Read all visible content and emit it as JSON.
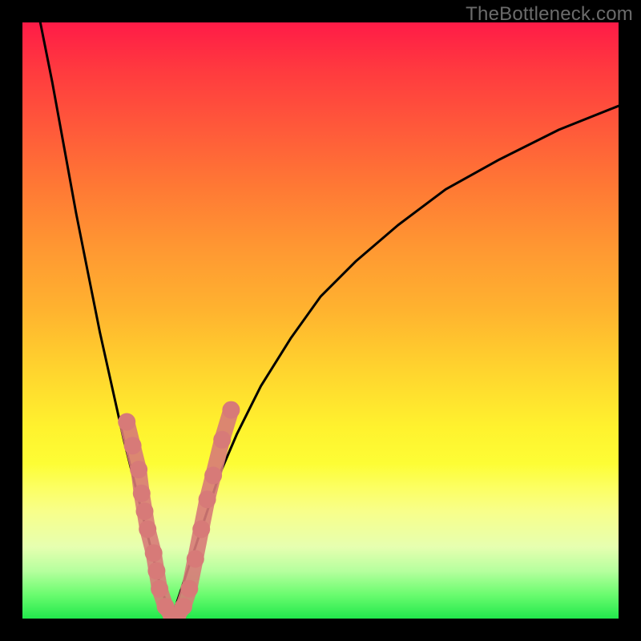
{
  "watermark": "TheBottleneck.com",
  "chart_data": {
    "type": "line",
    "title": "",
    "xlabel": "",
    "ylabel": "",
    "xlim": [
      0,
      100
    ],
    "ylim": [
      0,
      100
    ],
    "grid": false,
    "legend": false,
    "note": "V-shaped bottleneck curve over a vertical red→yellow→green gradient. Values estimated from pixel positions; no axis ticks or data labels are rendered in the image.",
    "series": [
      {
        "name": "curve-left",
        "x": [
          3,
          5,
          7,
          9,
          11,
          13,
          15,
          17,
          19,
          21,
          22,
          23,
          24,
          25
        ],
        "y": [
          100,
          90,
          79,
          68,
          58,
          48,
          39,
          30,
          22,
          14,
          10,
          6,
          3,
          0
        ]
      },
      {
        "name": "curve-right",
        "x": [
          25,
          27,
          29,
          31,
          33,
          36,
          40,
          45,
          50,
          56,
          63,
          71,
          80,
          90,
          100
        ],
        "y": [
          0,
          6,
          12,
          18,
          24,
          31,
          39,
          47,
          54,
          60,
          66,
          72,
          77,
          82,
          86
        ]
      }
    ],
    "markers": {
      "name": "scatter-pink",
      "color": "#d77a78",
      "points": [
        {
          "x": 17.5,
          "y": 33
        },
        {
          "x": 18.5,
          "y": 29
        },
        {
          "x": 19.5,
          "y": 25
        },
        {
          "x": 20.0,
          "y": 21
        },
        {
          "x": 20.5,
          "y": 18
        },
        {
          "x": 21.0,
          "y": 15
        },
        {
          "x": 22.0,
          "y": 11
        },
        {
          "x": 22.5,
          "y": 8
        },
        {
          "x": 23.0,
          "y": 5
        },
        {
          "x": 24.0,
          "y": 2
        },
        {
          "x": 25.0,
          "y": 0.5
        },
        {
          "x": 26.0,
          "y": 0.5
        },
        {
          "x": 27.0,
          "y": 2
        },
        {
          "x": 28.0,
          "y": 5
        },
        {
          "x": 29.0,
          "y": 10
        },
        {
          "x": 30.0,
          "y": 15
        },
        {
          "x": 31.0,
          "y": 20
        },
        {
          "x": 32.0,
          "y": 24
        },
        {
          "x": 33.5,
          "y": 30
        },
        {
          "x": 35.0,
          "y": 35
        }
      ]
    }
  }
}
